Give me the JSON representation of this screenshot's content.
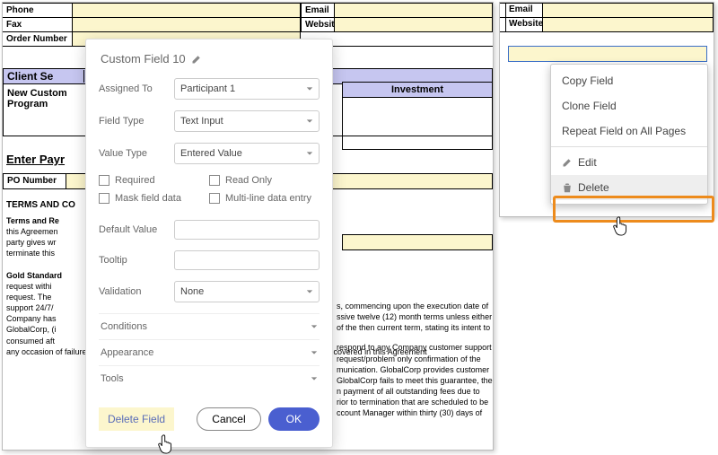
{
  "bg": {
    "phone": "Phone",
    "email": "Email",
    "fax": "Fax",
    "website": "Website",
    "order_number": "Order Number",
    "client_se": "Client Se",
    "investment": "Investment",
    "new_custom": "New Custom",
    "program": "Program",
    "enter_pay": "Enter Payr",
    "po_number": "PO Number",
    "terms_hdr": "TERMS AND CO",
    "terms_p1a": "Terms and Re",
    "terms_p1b": "this Agreemen",
    "terms_p1c": "party gives wr",
    "terms_p1d": "terminate this",
    "terms_p1r1": "s, commencing upon the execution date of",
    "terms_p1r2": "ssive twelve (12) month terms unless either",
    "terms_p1r3": "of the then current term, stating its intent to",
    "terms_p2a": "Gold Standard",
    "terms_p2b": "request withi",
    "terms_p2c": "request. The",
    "terms_p2d": "support 24/7/",
    "terms_p2e": "Company has",
    "terms_p2f": "GlobalCorp, (i",
    "terms_p2g": "consumed aft",
    "terms_p2h": "any occasion of failure.",
    "terms_p2r1": "respond to any Company customer support",
    "terms_p2r2": "request/problem only confirmation of the",
    "terms_p2r3": "munication. GlobalCorp provides customer",
    "terms_p2r4": "GlobalCorp fails to meet this guarantee, the",
    "terms_p2r5": "n payment of all outstanding fees due to",
    "terms_p2r6": "rior to termination that are scheduled to be",
    "terms_p2r7": "ccount Manager within thirty (30) days of",
    "terms_p2r8": "eet this guarantee.  Temporary shut downs due to Force Majeure as covered in this Agreement"
  },
  "dialog": {
    "title": "Custom Field 10",
    "assigned_to_lbl": "Assigned To",
    "assigned_to_val": "Participant 1",
    "field_type_lbl": "Field Type",
    "field_type_val": "Text Input",
    "value_type_lbl": "Value Type",
    "value_type_val": "Entered Value",
    "chk_required": "Required",
    "chk_readonly": "Read Only",
    "chk_mask": "Mask field data",
    "chk_multiline": "Multi-line data entry",
    "default_value_lbl": "Default Value",
    "tooltip_lbl": "Tooltip",
    "validation_lbl": "Validation",
    "validation_val": "None",
    "sec_conditions": "Conditions",
    "sec_appearance": "Appearance",
    "sec_tools": "Tools",
    "btn_delete": "Delete Field",
    "btn_cancel": "Cancel",
    "btn_ok": "OK"
  },
  "ctx": {
    "copy": "Copy Field",
    "clone": "Clone Field",
    "repeat": "Repeat Field on All Pages",
    "edit": "Edit",
    "delete": "Delete"
  },
  "right": {
    "email": "Email",
    "website": "Website"
  }
}
